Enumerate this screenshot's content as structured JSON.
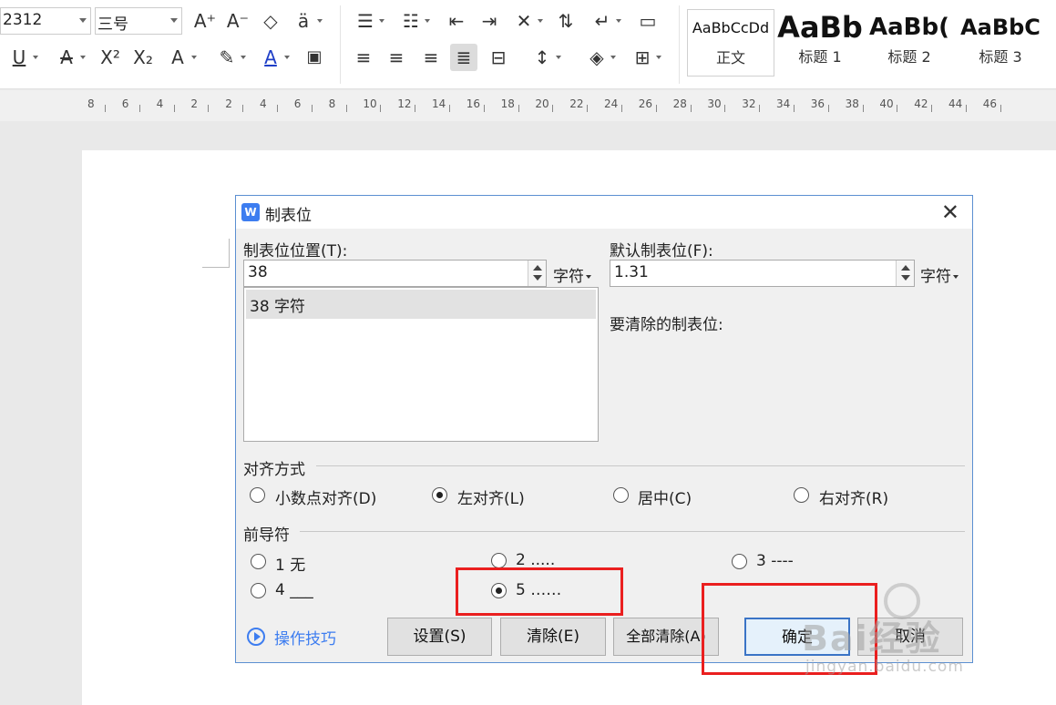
{
  "toolbar": {
    "font_size_value": "2312",
    "font_size_name": "三号",
    "styles": [
      {
        "sample": "AaBbCcDd",
        "name": "正文"
      },
      {
        "sample": "AaBb",
        "name": "标题 1"
      },
      {
        "sample": "AaBb(",
        "name": "标题 2"
      },
      {
        "sample": "AaBbC",
        "name": "标题 3"
      }
    ]
  },
  "ruler": {
    "labels": [
      "8",
      "6",
      "4",
      "2",
      "2",
      "4",
      "6",
      "8",
      "10",
      "12",
      "14",
      "16",
      "18",
      "20",
      "22",
      "24",
      "26",
      "28",
      "30",
      "32",
      "34",
      "36",
      "38",
      "40",
      "42",
      "44",
      "46"
    ]
  },
  "dialog": {
    "title": "制表位",
    "close_glyph": "✕",
    "tab_position_label": "制表位位置(T):",
    "tab_position_value": "38",
    "tab_position_unit": "字符",
    "default_tab_label": "默认制表位(F):",
    "default_tab_value": "1.31",
    "default_tab_unit": "字符",
    "list_items": [
      "38 字符"
    ],
    "clear_label": "要清除的制表位:",
    "alignment": {
      "title": "对齐方式",
      "options": [
        "小数点对齐(D)",
        "左对齐(L)",
        "居中(C)",
        "右对齐(R)"
      ],
      "selected": "左对齐(L)"
    },
    "leader": {
      "title": "前导符",
      "options": [
        "1 无",
        "2 .....",
        "3 ----",
        "4 ___",
        "5 ……"
      ],
      "selected": "5 ……"
    },
    "tips": "操作技巧",
    "buttons": {
      "set": "设置(S)",
      "clear": "清除(E)",
      "clear_all": "全部清除(A)",
      "ok": "确定",
      "cancel": "取消"
    }
  },
  "watermark": {
    "brand": "Bai经验",
    "url": "jingyan.baidu.com"
  }
}
